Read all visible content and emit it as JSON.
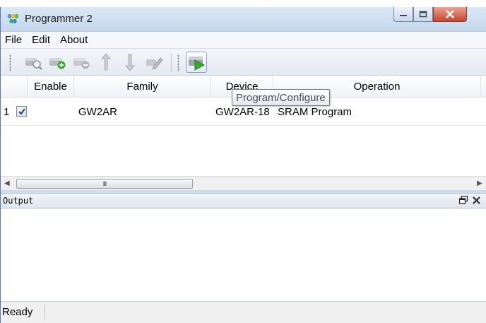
{
  "window": {
    "title": "Programmer 2",
    "controls": [
      "minimize",
      "maximize",
      "close"
    ]
  },
  "menu": {
    "items": [
      "File",
      "Edit",
      "About"
    ]
  },
  "toolbar": {
    "buttons": [
      {
        "icon": "scan-device-icon",
        "enabled": false
      },
      {
        "icon": "add-device-icon",
        "enabled": false
      },
      {
        "icon": "remove-device-icon",
        "enabled": false
      },
      {
        "icon": "move-up-icon",
        "enabled": false
      },
      {
        "icon": "move-down-icon",
        "enabled": false
      },
      {
        "icon": "edit-config-icon",
        "enabled": false
      },
      {
        "icon": "program-configure-icon",
        "enabled": true
      }
    ],
    "tooltip": "Program/Configure"
  },
  "table": {
    "columns": [
      "Enable",
      "Family",
      "Device",
      "Operation"
    ],
    "rows": [
      {
        "index": "1",
        "enabled": true,
        "family": "GW2AR",
        "device": "GW2AR-18",
        "operation": "SRAM Program"
      }
    ],
    "scrollbar_grip": "III"
  },
  "output": {
    "title": "Output",
    "float_icon": "restore-window-icon",
    "close_icon": "close-icon"
  },
  "status": {
    "text": "Ready"
  },
  "colors": {
    "title_gradient_top": "#dce8f5",
    "close_button": "#c7452e",
    "icon_green": "#3aa82e",
    "icon_gray": "#a7acb3"
  }
}
